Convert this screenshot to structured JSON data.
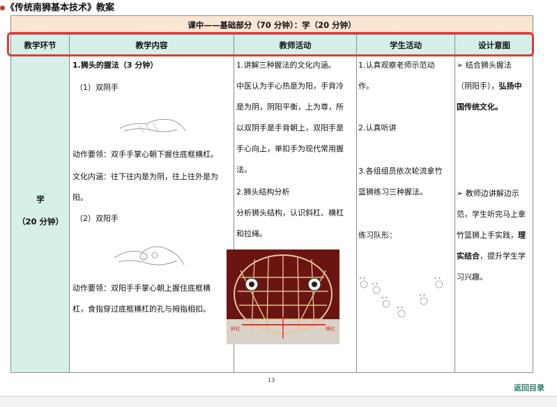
{
  "doc": {
    "title": "《传统南狮基本技术》教案"
  },
  "banner": {
    "text": "课中——基础部分（70 分钟）：学（20 分钟）"
  },
  "headers": [
    "教学环节",
    "教学内容",
    "教师活动",
    "学生活动",
    "设计意图"
  ],
  "stage": {
    "name": "学",
    "duration": "（20 分钟）"
  },
  "content": {
    "heading": "1.狮头的握法（3 分钟）",
    "sub1": "（1）双阴手",
    "lead1": "动作要领：双手手掌心朝下握住底框横杠。",
    "lead2a": "文化内涵：往下往内是为阴，往上往外是为",
    "lead2b": "阳。",
    "sub2": "（2）双阳手",
    "lead3a": "动作要领：双阳手手掌心朝上握住底框横",
    "lead3b": "杠，食指穿过底框横杠的孔与拇指相扣。"
  },
  "teacher": {
    "l1": "1.讲解三种握法的文化内涵。",
    "l2": "中医认为手心热是为阳，手背冷",
    "l3": "是为阴，阴阳平衡，上为尊，所",
    "l4": "以双阴手是手背朝上，双阳手是",
    "l5": "手心向上，单扣手为现代常用握",
    "l6": "法。",
    "l7": "2.狮头结构分析",
    "l8": "分析狮头结构，认识斜杠、横杠",
    "l9": "和拉绳。",
    "photo_labels": [
      "斜杠",
      "横杠"
    ]
  },
  "student": {
    "l1": "1.认真观察老师示范动",
    "l2": "作。",
    "l3": "2.认真听讲",
    "l4": "3.各组组员依次轮流拿竹",
    "l5": "篮狮练习三种握法。",
    "l6": "练习队形："
  },
  "intent": {
    "l1": "➢  结合狮头握法",
    "l2": "（阴阳手），",
    "l2b": "弘扬中",
    "l3": "国传统文化。",
    "l4": "➢  教师边讲解边示",
    "l5": "范，学生听完马上拿",
    "l6": "竹篮狮上手实践，",
    "l6b": "理",
    "l7": "实结合",
    "l7b": "，提升学生学",
    "l8": "习兴趣。"
  },
  "footer": {
    "page": "13",
    "back": "返回目录"
  },
  "colors": {
    "banner_bg": "#fbe6d4",
    "header_bg": "#d6efe8",
    "highlight": "#e03a3a",
    "link": "#2e7d6b"
  }
}
